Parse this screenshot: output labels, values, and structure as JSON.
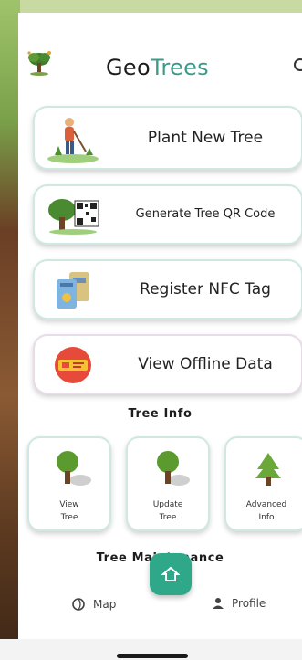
{
  "app": {
    "title_part1": "Geo",
    "title_part2": "Trees",
    "accent_color": "#3d9b8a",
    "fab_color": "#2ea888"
  },
  "actions": [
    {
      "label": "Plant New Tree",
      "icon": "planting-person-icon"
    },
    {
      "label": "Generate Tree QR Code",
      "icon": "tree-qr-code-icon"
    },
    {
      "label": "Register NFC Tag",
      "icon": "nfc-tag-icon"
    },
    {
      "label": "View Offline Data",
      "icon": "offline-data-icon"
    }
  ],
  "tree_info": {
    "title": "Tree Info",
    "cards": [
      {
        "label_line1": "View",
        "label_line2": "Tree",
        "icon": "tree-icon"
      },
      {
        "label_line1": "Update",
        "label_line2": "Tree",
        "icon": "tree-update-icon"
      },
      {
        "label_line1": "Advanced",
        "label_line2": "Info",
        "icon": "leafy-tree-icon"
      }
    ]
  },
  "maintenance": {
    "title": "Tree Maintenance"
  },
  "bottom_nav": {
    "map_label": "Map",
    "profile_label": "Profile",
    "home_icon": "home-icon"
  }
}
